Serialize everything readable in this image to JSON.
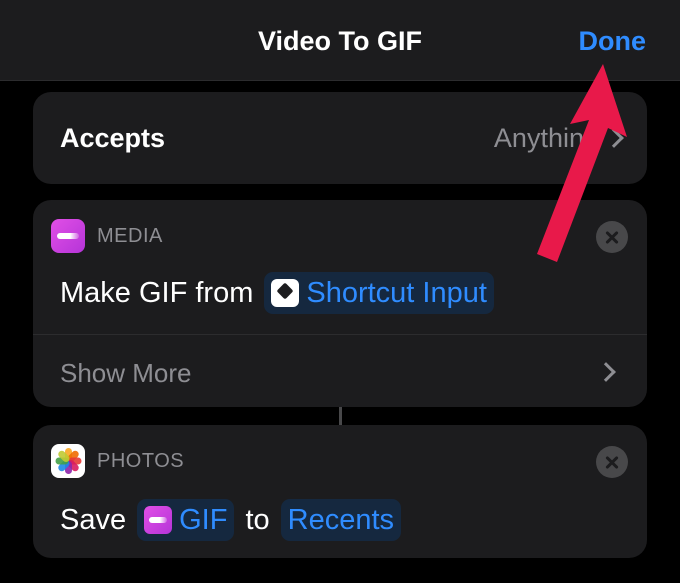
{
  "navbar": {
    "title": "Video To GIF",
    "done_label": "Done"
  },
  "accepts": {
    "label": "Accepts",
    "value": "Anything"
  },
  "actions": [
    {
      "category": "MEDIA",
      "icon": "media-icon",
      "words": [
        "Make GIF from"
      ],
      "token": "Shortcut Input",
      "token_icon": "shortcut-icon",
      "show_more": "Show More"
    },
    {
      "category": "PHOTOS",
      "icon": "photos-icon",
      "word_save": "Save",
      "token_gif": "GIF",
      "word_to": "to",
      "token_album": "Recents"
    }
  ],
  "colors": {
    "accent": "#2f8cff",
    "annotation_arrow": "#e8194a",
    "card_background": "#1c1c1e",
    "secondary_text": "#8e8e93"
  }
}
